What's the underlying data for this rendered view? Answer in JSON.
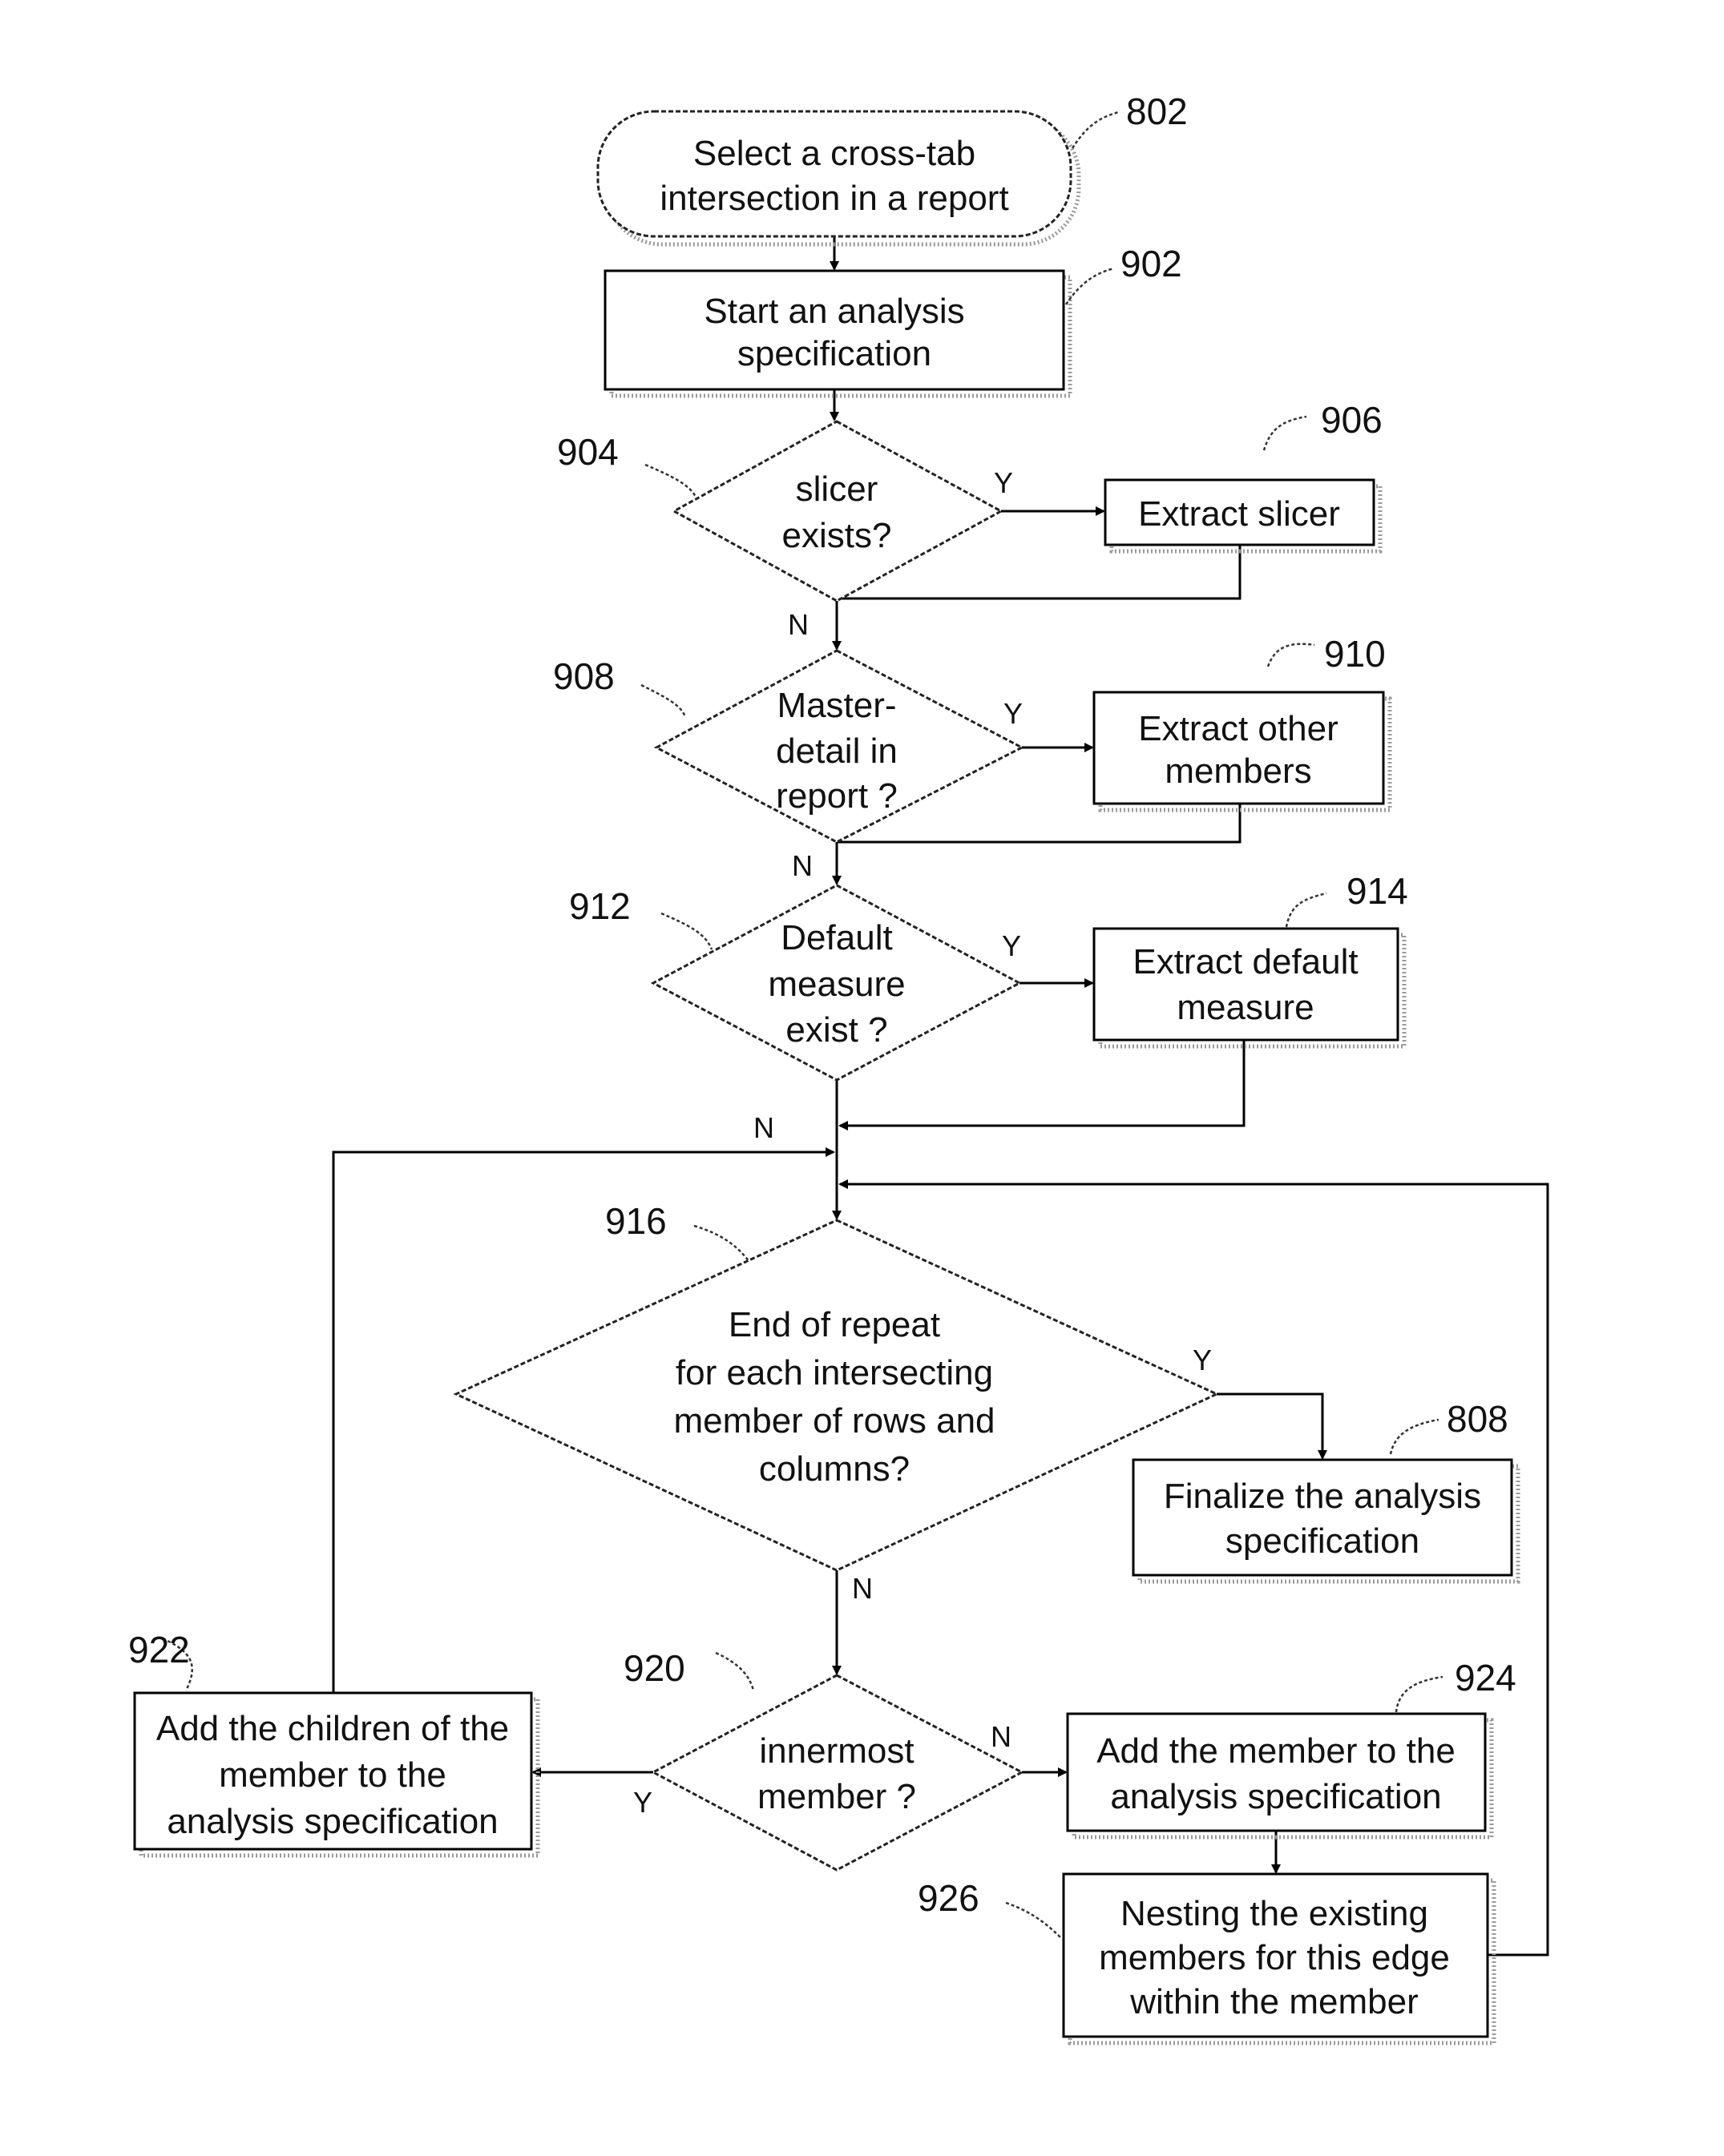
{
  "figure": {
    "nodes": {
      "n802": {
        "ref": "802",
        "type": "terminal",
        "lines": [
          "Select a cross-tab",
          "intersection in a report"
        ]
      },
      "n902": {
        "ref": "902",
        "type": "process",
        "lines": [
          "Start an analysis",
          "specification"
        ]
      },
      "n904": {
        "ref": "904",
        "type": "decision",
        "lines": [
          "slicer",
          "exists?"
        ]
      },
      "n906": {
        "ref": "906",
        "type": "process",
        "lines": [
          "Extract  slicer"
        ]
      },
      "n908": {
        "ref": "908",
        "type": "decision",
        "lines": [
          "Master-",
          "detail in",
          "report ?"
        ]
      },
      "n910": {
        "ref": "910",
        "type": "process",
        "lines": [
          "Extract  other",
          "members"
        ]
      },
      "n912": {
        "ref": "912",
        "type": "decision",
        "lines": [
          "Default",
          "measure",
          "exist ?"
        ]
      },
      "n914": {
        "ref": "914",
        "type": "process",
        "lines": [
          "Extract  default",
          "measure"
        ]
      },
      "n916": {
        "ref": "916",
        "type": "decision",
        "lines": [
          "End of repeat",
          "for each intersecting",
          "member of rows and",
          "columns?"
        ]
      },
      "n808": {
        "ref": "808",
        "type": "process",
        "lines": [
          "Finalize the analysis",
          "specification"
        ]
      },
      "n920": {
        "ref": "920",
        "type": "decision",
        "lines": [
          "innermost",
          "member ?"
        ]
      },
      "n922": {
        "ref": "922",
        "type": "process",
        "lines": [
          "Add the children of the",
          "member to the",
          "analysis specification"
        ]
      },
      "n924": {
        "ref": "924",
        "type": "process",
        "lines": [
          "Add the member to the",
          "analysis specification"
        ]
      },
      "n926": {
        "ref": "926",
        "type": "process",
        "lines": [
          "Nesting the existing",
          "members for this edge",
          "within the member"
        ]
      }
    },
    "branch_labels": {
      "yes": "Y",
      "no": "N"
    }
  }
}
